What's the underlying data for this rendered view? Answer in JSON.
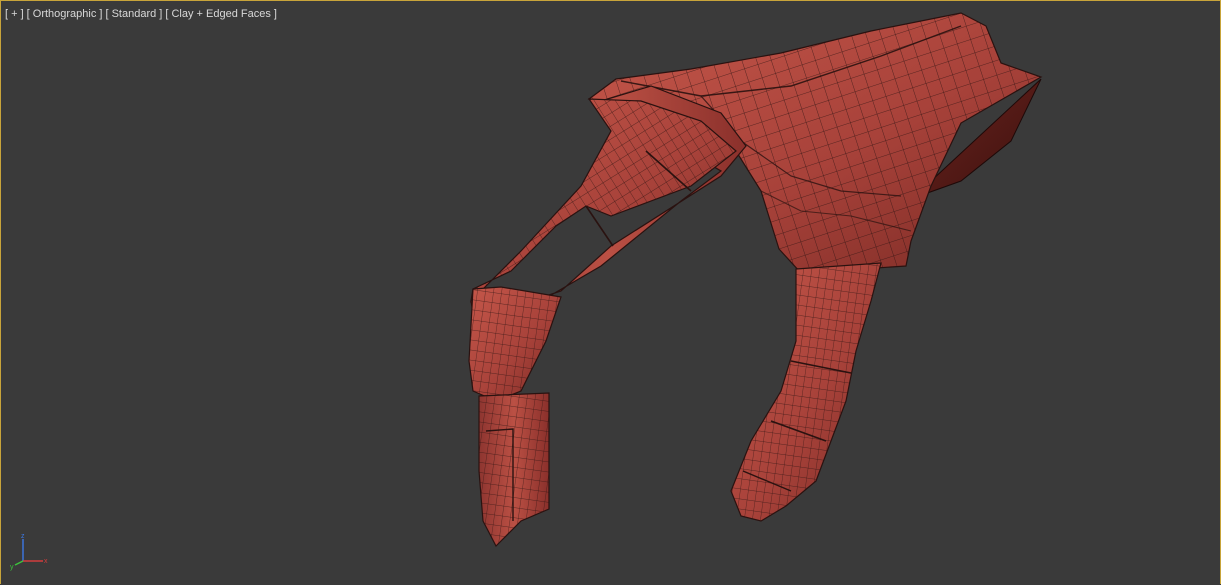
{
  "viewport": {
    "labels": [
      "[ + ]",
      "[ Orthographic ]",
      "[ Standard ]",
      "[ Clay + Edged Faces ]"
    ],
    "border_color": "#c8a43a",
    "background_color": "#3a3a3a"
  },
  "model": {
    "subject": "hand mesh",
    "color": "#b0483c",
    "edge_color": "#2a1210"
  },
  "axis_gizmo": {
    "x_label": "x",
    "y_label": "y",
    "z_label": "z",
    "x_color": "#d23c3c",
    "y_color": "#3cc43c",
    "z_color": "#3c78e6"
  }
}
